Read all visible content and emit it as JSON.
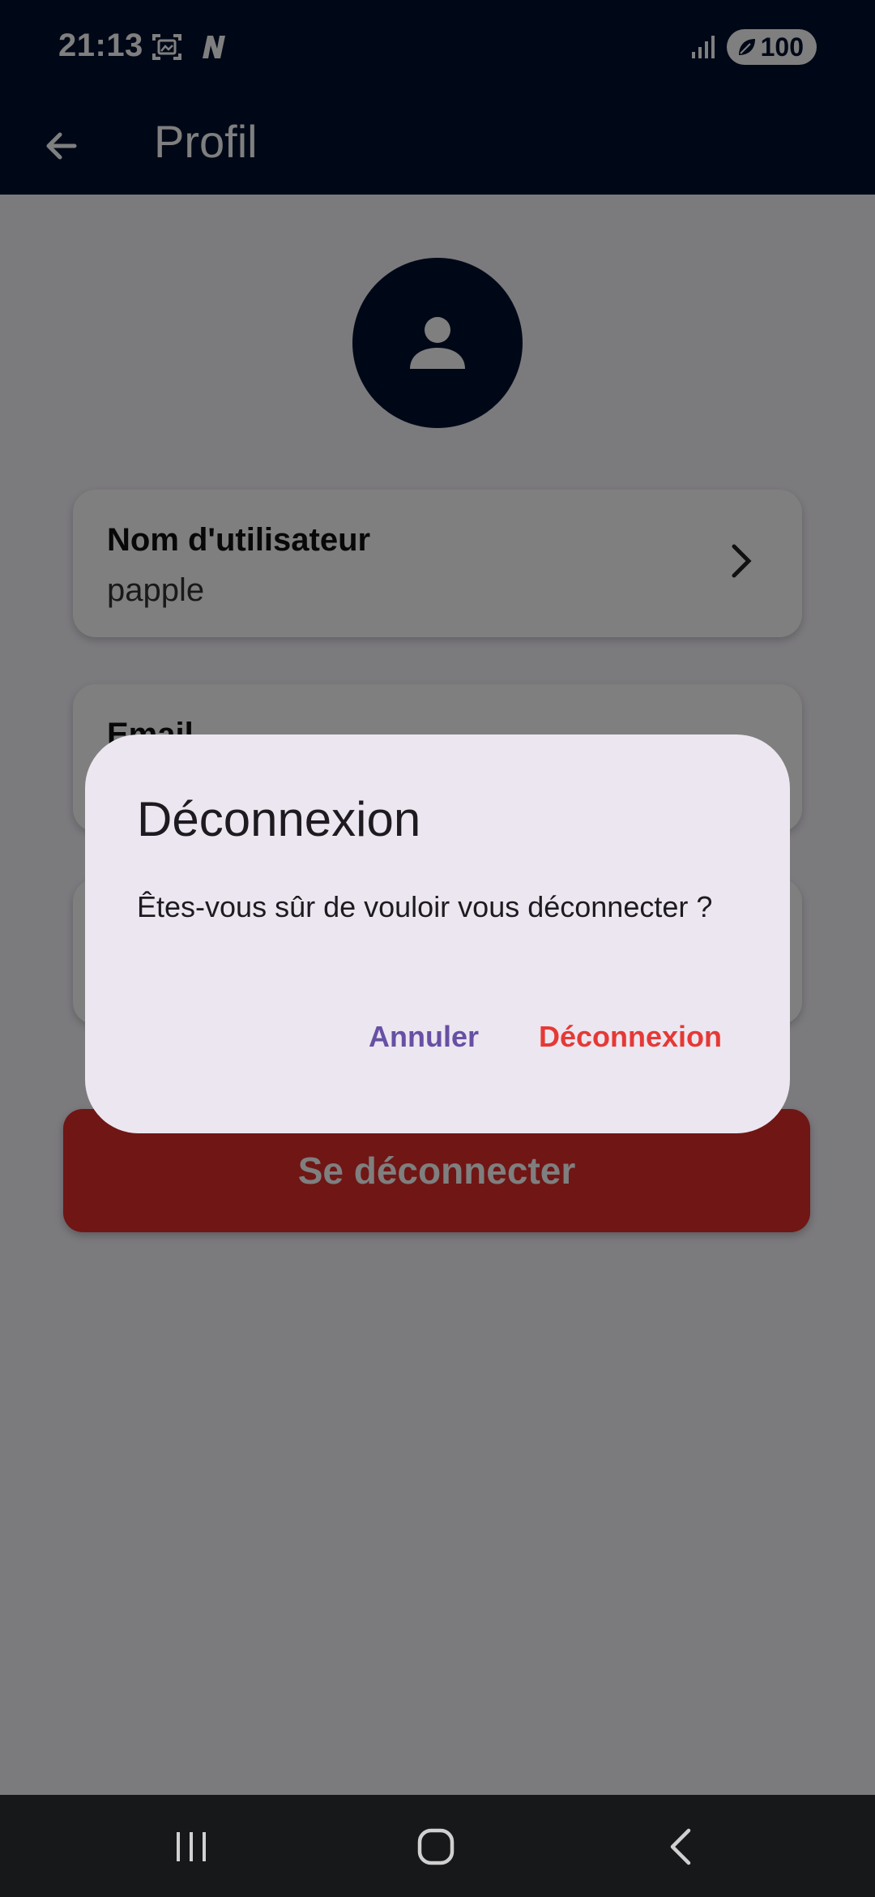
{
  "status": {
    "time": "21:13",
    "battery": "100"
  },
  "appbar": {
    "title": "Profil"
  },
  "profile": {
    "username_label": "Nom d'utilisateur",
    "username_value": "papple",
    "email_label": "Email"
  },
  "logout_button": "Se déconnecter",
  "dialog": {
    "title": "Déconnexion",
    "message": "Êtes-vous sûr de vouloir vous déconnecter ?",
    "cancel": "Annuler",
    "confirm": "Déconnexion"
  },
  "colors": {
    "primary": "#00102e",
    "danger": "#e02d2a",
    "dialog_cancel": "#6750a4",
    "dialog_confirm": "#e53935"
  }
}
